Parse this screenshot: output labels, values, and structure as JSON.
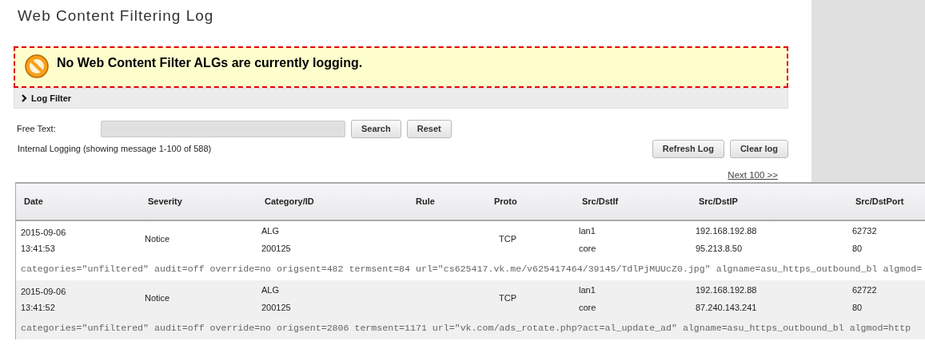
{
  "title": "Web Content Filtering Log",
  "alert": {
    "text": "No Web Content Filter ALGs are currently logging."
  },
  "filter_panel": {
    "label": "Log Filter",
    "expanded": false
  },
  "free_text": {
    "label": "Free Text:"
  },
  "filter_buttons": [
    "Search",
    "Reset"
  ],
  "status": "Internal Logging (showing message 1-100 of 588)",
  "log_buttons": [
    "Refresh Log",
    "Clear log"
  ],
  "next_link": "Next 100 >>",
  "table": {
    "columns": [
      "Date",
      "Severity",
      "Category/ID",
      "Rule",
      "Proto",
      "Src/DstIf",
      "Src/DstIP",
      "Src/DstPort"
    ],
    "rows": [
      {
        "date": "2015-09-06",
        "time": "13:41:53",
        "severity": "Notice",
        "category": "ALG",
        "id": "200125",
        "proto": "TCP",
        "src_if": "lan1",
        "dst_if": "core",
        "src_ip": "192.168.192.88",
        "dst_ip": "95.213.8.50",
        "src_port": "62732",
        "dst_port": "80",
        "details": "categories=\"unfiltered\" audit=off override=no origsent=482 termsent=84 url=\"cs625417.vk.me/v625417464/39145/TdlPjMUUcZ0.jpg\" algname=asu_https_outbound_bl algmod="
      },
      {
        "date": "2015-09-06",
        "time": "13:41:52",
        "severity": "Notice",
        "category": "ALG",
        "id": "200125",
        "proto": "TCP",
        "src_if": "lan1",
        "dst_if": "core",
        "src_ip": "192.168.192.88",
        "dst_ip": "87.240.143.241",
        "src_port": "62722",
        "dst_port": "80",
        "details": "categories=\"unfiltered\" audit=off override=no origsent=2806 termsent=1171 url=\"vk.com/ads_rotate.php?act=al_update_ad\" algname=asu_https_outbound_bl algmod=http"
      }
    ]
  }
}
